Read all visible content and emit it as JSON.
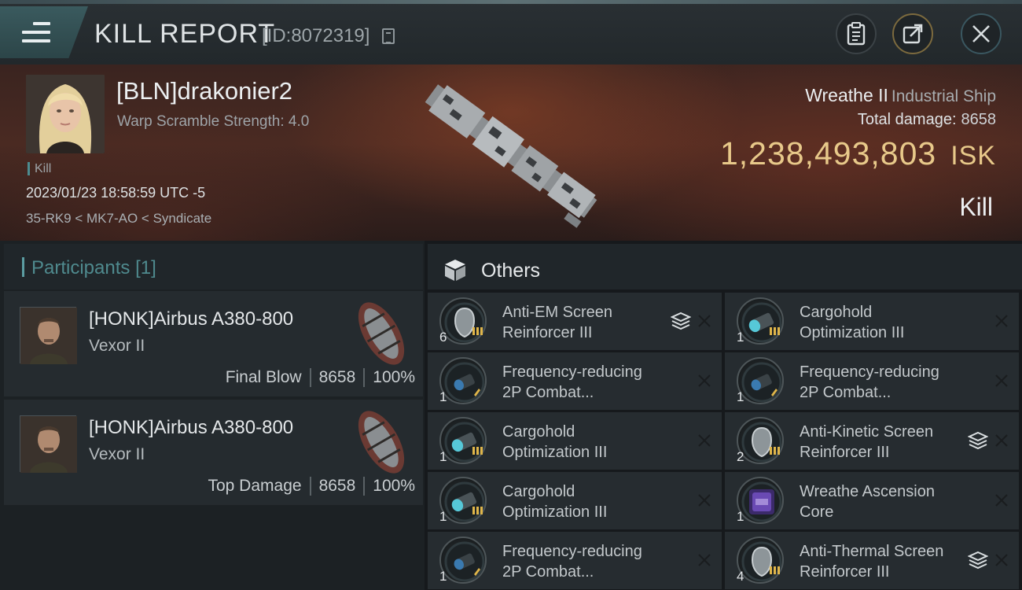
{
  "header": {
    "title": "KILL REPORT",
    "report_id": "[ID:8072319]",
    "icons": [
      "menu-icon",
      "copy-icon",
      "clipboard-icon",
      "share-icon",
      "close-icon"
    ]
  },
  "victim": {
    "name": "[BLN]drakonier2",
    "scramble": "Warp Scramble Strength: 4.0",
    "type_tag": "Kill",
    "timestamp": "2023/01/23 18:58:59 UTC -5",
    "location": "35-RK9 < MK7-AO < Syndicate",
    "ship_name": "Wreathe II",
    "ship_class": "Industrial Ship",
    "total_damage_label": "Total damage:",
    "total_damage": "8658",
    "isk_value": "1,238,493,803",
    "isk_unit": "ISK",
    "outcome": "Kill"
  },
  "participants": {
    "title": "Participants",
    "count": "[1]",
    "list": [
      {
        "name": "[HONK]Airbus A380-800",
        "ship": "Vexor II",
        "role": "Final Blow",
        "damage": "8658",
        "percent": "100%"
      },
      {
        "name": "[HONK]Airbus A380-800",
        "ship": "Vexor II",
        "role": "Top Damage",
        "damage": "8658",
        "percent": "100%"
      }
    ]
  },
  "others": {
    "title": "Others",
    "items": [
      {
        "name_1": "Anti-EM Screen",
        "name_2": "Reinforcer III",
        "qty": "6",
        "icon": "shield-module-icon"
      },
      {
        "name_1": "Cargohold",
        "name_2": "Optimization III",
        "qty": "1",
        "icon": "cargohold-rig-icon"
      },
      {
        "name_1": "Frequency-reducing",
        "name_2": "2P Combat...",
        "qty": "1",
        "icon": "lens-module-icon"
      },
      {
        "name_1": "Frequency-reducing",
        "name_2": "2P Combat...",
        "qty": "1",
        "icon": "lens-module-icon"
      },
      {
        "name_1": "Cargohold",
        "name_2": "Optimization III",
        "qty": "1",
        "icon": "cargohold-rig-icon"
      },
      {
        "name_1": "Anti-Kinetic Screen",
        "name_2": "Reinforcer III",
        "qty": "2",
        "icon": "shield-module-icon"
      },
      {
        "name_1": "Cargohold",
        "name_2": "Optimization III",
        "qty": "1",
        "icon": "cargohold-rig-icon"
      },
      {
        "name_1": "Wreathe Ascension",
        "name_2": "Core",
        "qty": "1",
        "icon": "ascension-core-icon"
      },
      {
        "name_1": "Frequency-reducing",
        "name_2": "2P Combat...",
        "qty": "1",
        "icon": "lens-module-icon"
      },
      {
        "name_1": "Anti-Thermal Screen",
        "name_2": "Reinforcer III",
        "qty": "4",
        "icon": "shield-module-icon"
      }
    ]
  },
  "colors": {
    "accent_teal": "#5b9da2",
    "isk_gold": "#e8c98a",
    "panel_bg": "#252b2f"
  }
}
